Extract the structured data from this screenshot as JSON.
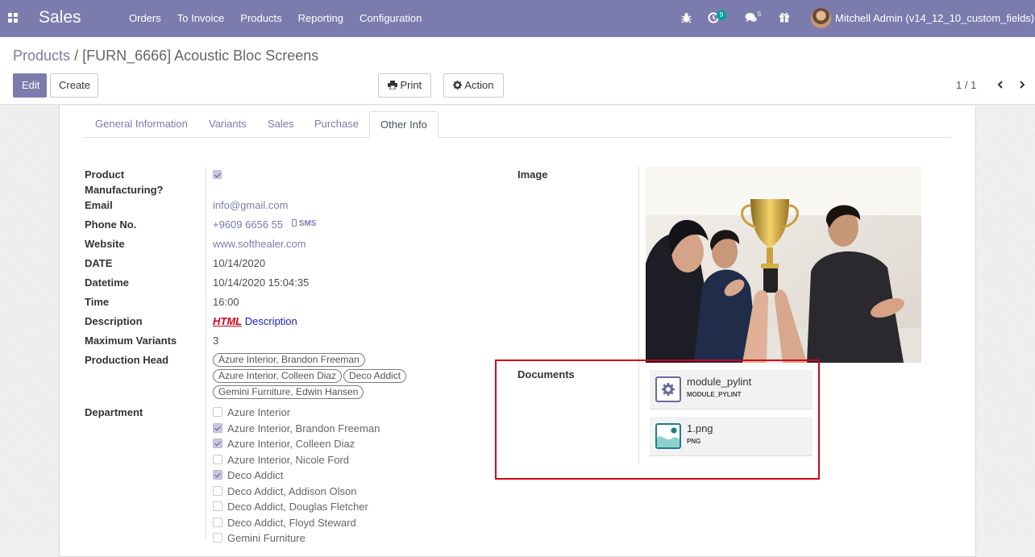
{
  "navbar": {
    "app_name": "Sales",
    "menu": [
      "Orders",
      "To Invoice",
      "Products",
      "Reporting",
      "Configuration"
    ],
    "activity_count": "9",
    "messages_count": "5",
    "user": "Mitchell Admin (v14_12_10_custom_fields)",
    "colors": {
      "navbar": "#7c7bad",
      "activity_badge": "#00a09d"
    }
  },
  "breadcrumb": {
    "parent": "Products",
    "separator": "/",
    "current": "[FURN_6666] Acoustic Bloc Screens"
  },
  "buttons": {
    "edit": "Edit",
    "create": "Create",
    "print": "Print",
    "action": "Action"
  },
  "pager": {
    "value": "1 / 1"
  },
  "tabs": [
    "General Information",
    "Variants",
    "Sales",
    "Purchase",
    "Other Info"
  ],
  "active_tab": "Other Info",
  "fields": {
    "product_manufacturing_label_1": "Product",
    "product_manufacturing_label_2": "Manufacturing?",
    "product_manufacturing_checked": true,
    "email_label": "Email",
    "email_value": "info@gmail.com",
    "phone_label": "Phone No.",
    "phone_value": "+9609 6656 55",
    "sms_label": "SMS",
    "website_label": "Website",
    "website_value": "www.softhealer.com",
    "date_label": "DATE",
    "date_value": "10/14/2020",
    "datetime_label": "Datetime",
    "datetime_value": "10/14/2020 15:04:35",
    "time_label": "Time",
    "time_value": "16:00",
    "description_label": "Description",
    "description_html": "HTML",
    "description_text": "Description",
    "max_variants_label": "Maximum Variants",
    "max_variants_value": "3",
    "production_head_label": "Production Head",
    "production_head_tags": [
      "Azure Interior, Brandon Freeman",
      "Azure Interior, Colleen Diaz",
      "Deco Addict",
      "Gemini Furniture, Edwin Hansen"
    ],
    "department_label": "Department",
    "department_options": [
      {
        "label": "Azure Interior",
        "checked": false
      },
      {
        "label": "Azure Interior, Brandon Freeman",
        "checked": true
      },
      {
        "label": "Azure Interior, Colleen Diaz",
        "checked": true
      },
      {
        "label": "Azure Interior, Nicole Ford",
        "checked": false
      },
      {
        "label": "Deco Addict",
        "checked": true
      },
      {
        "label": "Deco Addict, Addison Olson",
        "checked": false
      },
      {
        "label": "Deco Addict, Douglas Fletcher",
        "checked": false
      },
      {
        "label": "Deco Addict, Floyd Steward",
        "checked": false
      },
      {
        "label": "Gemini Furniture",
        "checked": false
      }
    ],
    "image_label": "Image",
    "documents_label": "Documents",
    "documents": [
      {
        "name": "module_pylint",
        "ext": "MODULE_PYLINT",
        "icon": "gear-icon"
      },
      {
        "name": "1.png",
        "ext": "PNG",
        "icon": "image-icon"
      }
    ]
  }
}
